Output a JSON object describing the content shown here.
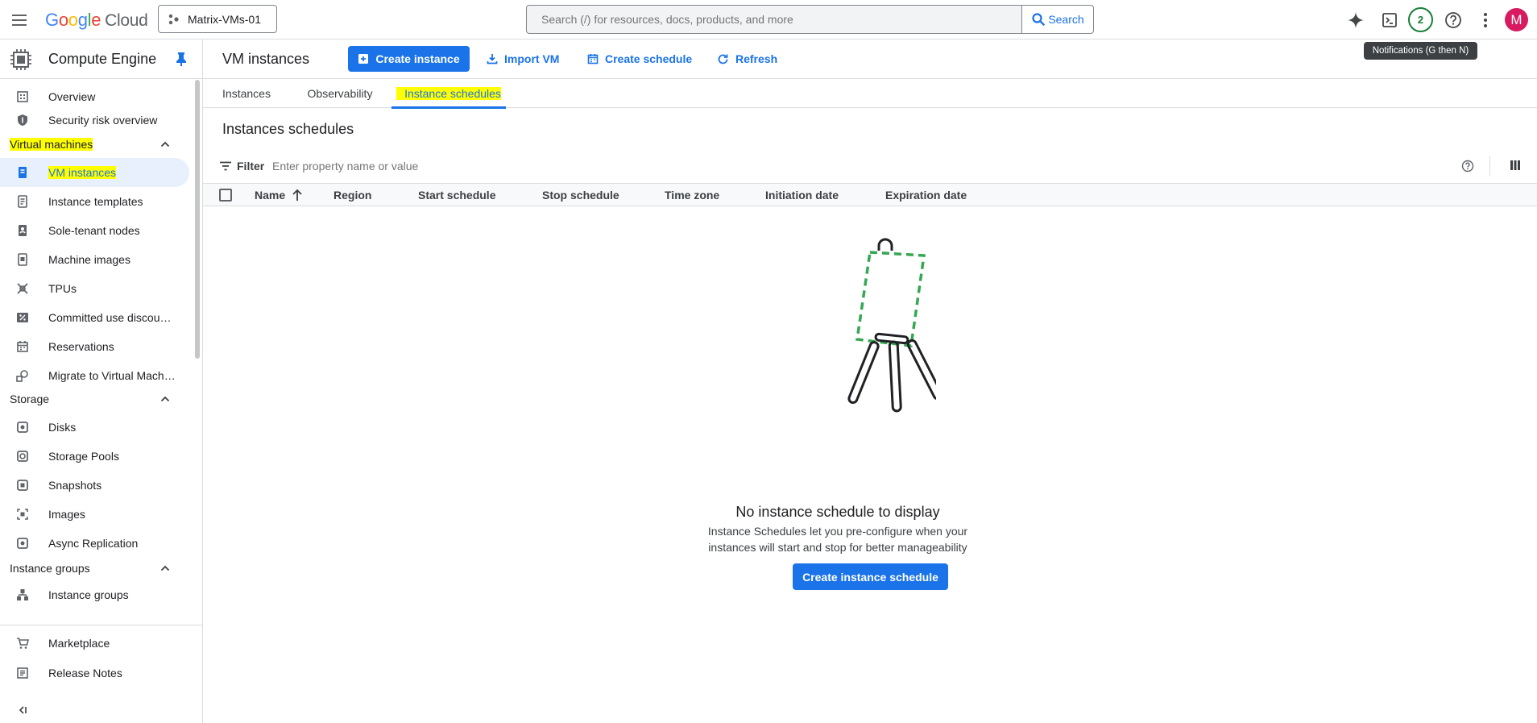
{
  "topbar": {
    "logo_google": [
      "G",
      "o",
      "o",
      "g",
      "l",
      "e"
    ],
    "logo_cloud": "Cloud",
    "project_name": "Matrix-VMs-01",
    "search_placeholder": "Search (/) for resources, docs, products, and more",
    "search_button": "Search",
    "notification_count": "2",
    "avatar_initial": "M",
    "tooltip": "Notifications (G then N)"
  },
  "sidebar": {
    "title": "Compute Engine",
    "items_top": [
      {
        "label": "Overview",
        "icon": "overview-icon"
      },
      {
        "label": "Security risk overview",
        "icon": "shield-icon"
      }
    ],
    "sections": [
      {
        "label": "Virtual machines",
        "items": [
          {
            "label": "VM instances",
            "icon": "vm-instance-icon",
            "active": true
          },
          {
            "label": "Instance templates",
            "icon": "template-icon"
          },
          {
            "label": "Sole-tenant nodes",
            "icon": "sole-tenant-icon"
          },
          {
            "label": "Machine images",
            "icon": "machine-image-icon"
          },
          {
            "label": "TPUs",
            "icon": "tpu-icon"
          },
          {
            "label": "Committed use discou…",
            "icon": "percent-icon"
          },
          {
            "label": "Reservations",
            "icon": "calendar-icon"
          },
          {
            "label": "Migrate to Virtual Mach…",
            "icon": "migrate-icon"
          }
        ]
      },
      {
        "label": "Storage",
        "items": [
          {
            "label": "Disks",
            "icon": "disk-icon"
          },
          {
            "label": "Storage Pools",
            "icon": "storage-pool-icon"
          },
          {
            "label": "Snapshots",
            "icon": "snapshot-icon"
          },
          {
            "label": "Images",
            "icon": "images-icon"
          },
          {
            "label": "Async Replication",
            "icon": "replication-icon"
          }
        ]
      },
      {
        "label": "Instance groups",
        "items": [
          {
            "label": "Instance groups",
            "icon": "instance-groups-icon"
          }
        ]
      }
    ],
    "bottom": [
      {
        "label": "Marketplace",
        "icon": "cart-icon"
      },
      {
        "label": "Release Notes",
        "icon": "notes-icon"
      }
    ]
  },
  "main": {
    "page_title": "VM instances",
    "actions": {
      "create_instance": "Create instance",
      "import_vm": "Import VM",
      "create_schedule": "Create schedule",
      "refresh": "Refresh"
    },
    "tabs": [
      "Instances",
      "Observability",
      "Instance schedules"
    ],
    "active_tab": "Instance schedules",
    "section_title": "Instances schedules",
    "filter_label": "Filter",
    "filter_placeholder": "Enter property name or value",
    "columns": [
      "Name",
      "Region",
      "Start schedule",
      "Stop schedule",
      "Time zone",
      "Initiation date",
      "Expiration date"
    ],
    "empty": {
      "title": "No instance schedule to display",
      "description": "Instance Schedules let you pre-configure when your instances will start and stop for better manageability",
      "button": "Create instance schedule"
    }
  },
  "colors": {
    "primary": "#1a73e8",
    "highlight": "#ffff00",
    "notification": "#188038",
    "avatar": "#d81b60",
    "easel_frame": "#34a853"
  }
}
